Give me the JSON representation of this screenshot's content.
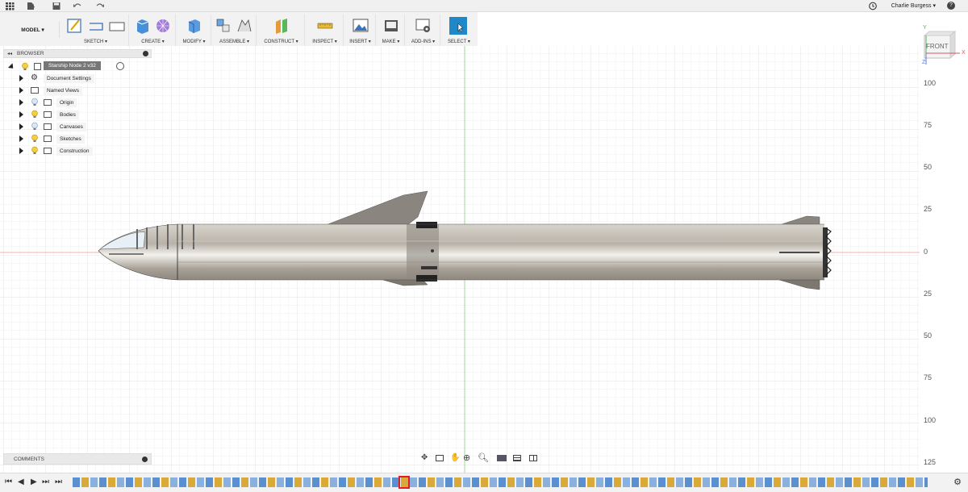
{
  "user": {
    "name": "Charlie Burgess ▾",
    "help": "?"
  },
  "toolbar": {
    "workspace": "MODEL ▾",
    "groups": [
      {
        "label": "SKETCH ▾"
      },
      {
        "label": "CREATE ▾"
      },
      {
        "label": "MODIFY ▾"
      },
      {
        "label": "ASSEMBLE ▾"
      },
      {
        "label": "CONSTRUCT ▾"
      },
      {
        "label": "INSPECT ▾"
      },
      {
        "label": "INSERT ▾"
      },
      {
        "label": "MAKE ▾"
      },
      {
        "label": "ADD-INS ▾"
      },
      {
        "label": "SELECT ▾"
      }
    ]
  },
  "browser": {
    "title": "BROWSER",
    "root": "Starship Node 2 v32",
    "items": [
      {
        "label": "Document Settings"
      },
      {
        "label": "Named Views"
      },
      {
        "label": "Origin"
      },
      {
        "label": "Bodies"
      },
      {
        "label": "Canvases"
      },
      {
        "label": "Sketches"
      },
      {
        "label": "Construction"
      }
    ]
  },
  "comments": {
    "title": "COMMENTS"
  },
  "viewcube": {
    "face": "FRONT",
    "axis_y": "Y",
    "axis_x": "X",
    "axis_z": "Z"
  },
  "ruler": {
    "labels": [
      "100",
      "75",
      "50",
      "25",
      "0",
      "25",
      "50",
      "75",
      "100",
      "125"
    ]
  },
  "colors": {
    "accent_select": "#1e88c9",
    "grid": "#e6e6e6",
    "axis_green": "#9fd49a",
    "axis_red": "#f0b0b0"
  }
}
